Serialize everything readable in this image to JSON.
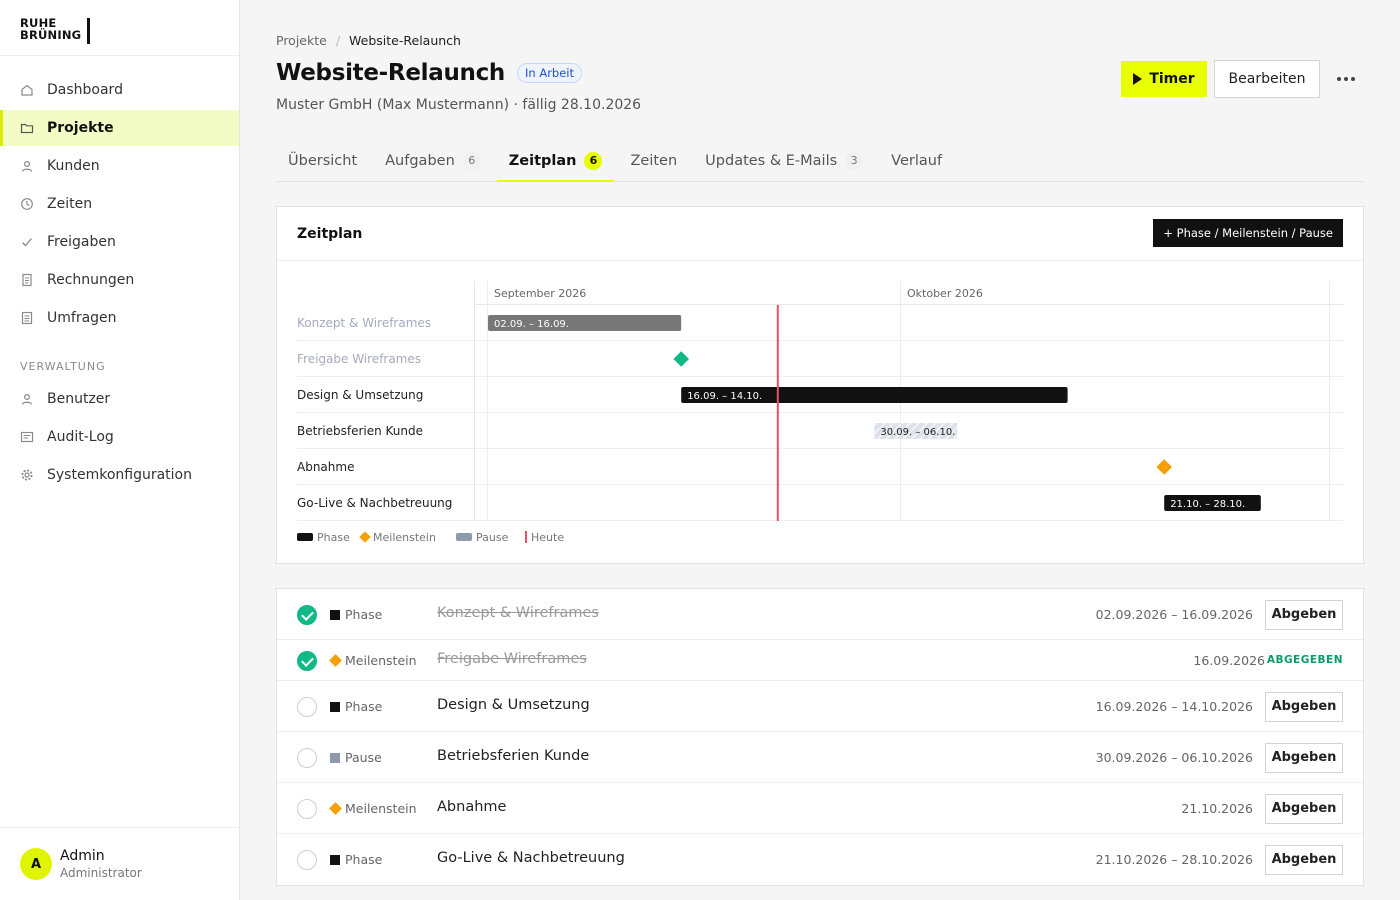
{
  "app": {
    "logo_line1": "RUHE",
    "logo_line2": "BRÜNING"
  },
  "sidebar": {
    "items": [
      {
        "label": "Dashboard",
        "icon": "home-icon"
      },
      {
        "label": "Projekte",
        "icon": "folder-icon",
        "active": true
      },
      {
        "label": "Kunden",
        "icon": "user-icon"
      },
      {
        "label": "Zeiten",
        "icon": "clock-icon"
      },
      {
        "label": "Freigaben",
        "icon": "check-icon"
      },
      {
        "label": "Rechnungen",
        "icon": "invoice-icon"
      },
      {
        "label": "Umfragen",
        "icon": "survey-icon"
      }
    ],
    "section_admin": "VERWALTUNG",
    "admin_items": [
      {
        "label": "Benutzer",
        "icon": "user-icon"
      },
      {
        "label": "Audit-Log",
        "icon": "log-icon"
      },
      {
        "label": "Systemkonfiguration",
        "icon": "gear-icon"
      }
    ],
    "user": {
      "initial": "A",
      "name": "Admin",
      "role": "Administrator"
    }
  },
  "header": {
    "breadcrumb": [
      "Projekte",
      "Website-Relaunch"
    ],
    "title": "Website-Relaunch",
    "status": "In Arbeit",
    "subtitle": "Muster GmbH (Max Mustermann) · fällig 28.10.2026",
    "timer_label": "Timer",
    "edit_label": "Bearbeiten"
  },
  "tabs": [
    {
      "label": "Übersicht",
      "count": ""
    },
    {
      "label": "Aufgaben",
      "count": "6"
    },
    {
      "label": "Zeitplan",
      "count": "6",
      "active": true
    },
    {
      "label": "Zeiten",
      "count": ""
    },
    {
      "label": "Updates & E-Mails",
      "count": "3"
    },
    {
      "label": "Verlauf",
      "count": ""
    }
  ],
  "schedule": {
    "title": "Zeitplan",
    "add_label": "+ Phase / Meilenstein / Pause"
  },
  "chart_data": {
    "type": "gantt",
    "months": [
      "September 2026",
      "Oktober 2026"
    ],
    "today": "2026-09-23",
    "rows": [
      {
        "name": "Konzept & Wireframes",
        "kind": "phase",
        "start": "2026-09-02",
        "end": "2026-09-16",
        "label": "02.09. – 16.09.",
        "done": true
      },
      {
        "name": "Freigabe Wireframes",
        "kind": "milestone",
        "date": "2026-09-16",
        "done": true
      },
      {
        "name": "Design & Umsetzung",
        "kind": "phase",
        "start": "2026-09-16",
        "end": "2026-10-14",
        "label": "16.09. – 14.10.",
        "done": false
      },
      {
        "name": "Betriebsferien Kunde",
        "kind": "pause",
        "start": "2026-09-30",
        "end": "2026-10-06",
        "label": "30.09. – 06.10.",
        "done": false
      },
      {
        "name": "Abnahme",
        "kind": "milestone",
        "date": "2026-10-21",
        "done": false
      },
      {
        "name": "Go-Live & Nachbetreuung",
        "kind": "phase",
        "start": "2026-10-21",
        "end": "2026-10-28",
        "label": "21.10. – 28.10.",
        "done": false
      }
    ],
    "legend": [
      "Phase",
      "Meilenstein",
      "Pause",
      "Heute"
    ],
    "colors": {
      "phase": "#111111",
      "phase_done": "#777777",
      "milestone": "#f59f00",
      "milestone_done": "#12b886",
      "pause": "#8f99ad",
      "today": "#e8506a"
    }
  },
  "tasks": [
    {
      "type": "Phase",
      "kind": "phase",
      "name": "Konzept & Wireframes",
      "date": "02.09.2026 – 16.09.2026",
      "done": true,
      "action": "Abgeben"
    },
    {
      "type": "Meilenstein",
      "kind": "milestone",
      "name": "Freigabe Wireframes",
      "date": "16.09.2026",
      "done": true,
      "action": "ABGEGEBEN"
    },
    {
      "type": "Phase",
      "kind": "phase",
      "name": "Design & Umsetzung",
      "date": "16.09.2026 – 14.10.2026",
      "done": false,
      "action": "Abgeben"
    },
    {
      "type": "Pause",
      "kind": "pause",
      "name": "Betriebsferien Kunde",
      "date": "30.09.2026 – 06.10.2026",
      "done": false,
      "action": "Abgeben"
    },
    {
      "type": "Meilenstein",
      "kind": "milestone",
      "name": "Abnahme",
      "date": "21.10.2026",
      "done": false,
      "action": "Abgeben"
    },
    {
      "type": "Phase",
      "kind": "phase",
      "name": "Go-Live & Nachbetreuung",
      "date": "21.10.2026 – 28.10.2026",
      "done": false,
      "action": "Abgeben"
    }
  ]
}
